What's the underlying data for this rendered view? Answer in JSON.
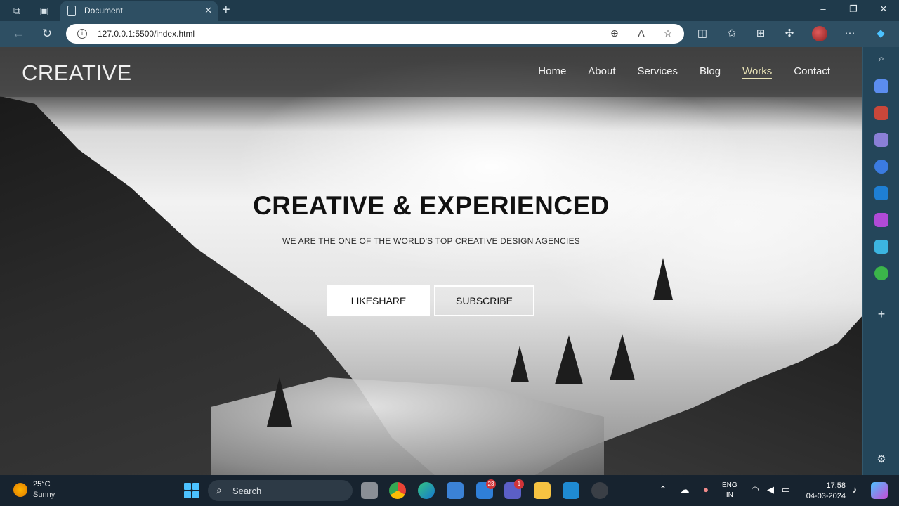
{
  "browser": {
    "tab_title": "Document",
    "url": "127.0.0.1:5500/index.html"
  },
  "site": {
    "logo": "CREATIVE",
    "nav": [
      "Home",
      "About",
      "Services",
      "Blog",
      "Works",
      "Contact"
    ],
    "active_nav": "Works",
    "hero_title": "CREATIVE & EXPERIENCED",
    "hero_subtitle": "WE ARE THE ONE OF THE WORLD'S TOP CREATIVE DESIGN AGENCIES",
    "btn_primary": "LIKESHARE",
    "btn_secondary": "SUBSCRIBE"
  },
  "taskbar": {
    "weather_temp": "25°C",
    "weather_desc": "Sunny",
    "search_label": "Search",
    "mail_badge": "23",
    "teams_badge": "1",
    "lang_1": "ENG",
    "lang_2": "IN",
    "time": "17:58",
    "date": "04-03-2024"
  },
  "colors": {
    "chrome_bg": "#1f3a4b",
    "header_overlay": "#464646",
    "active_nav": "#e9e3b6"
  },
  "icons": [
    "workspaces-icon",
    "tab-actions-icon",
    "document-icon",
    "close-icon",
    "new-tab-icon",
    "back-icon",
    "refresh-icon",
    "info-icon",
    "zoom-icon",
    "read-aloud-icon",
    "favorite-icon",
    "split-screen-icon",
    "favorites-icon",
    "collections-icon",
    "extensions-icon",
    "more-icon",
    "copilot-icon"
  ]
}
